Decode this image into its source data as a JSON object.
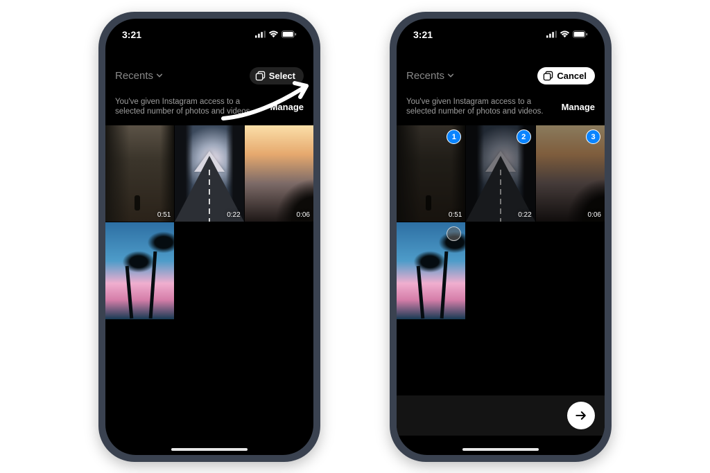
{
  "status": {
    "time": "3:21"
  },
  "picker": {
    "album_label": "Recents",
    "select_label": "Select",
    "cancel_label": "Cancel",
    "access_text": "You've given Instagram access to a selected number of photos and videos.",
    "manage_label": "Manage"
  },
  "media": [
    {
      "id": "fog",
      "duration": "0:51"
    },
    {
      "id": "road",
      "duration": "0:22"
    },
    {
      "id": "sunset",
      "duration": "0:06"
    },
    {
      "id": "palm",
      "duration": ""
    }
  ],
  "selection_badges": [
    "1",
    "2",
    "3"
  ]
}
